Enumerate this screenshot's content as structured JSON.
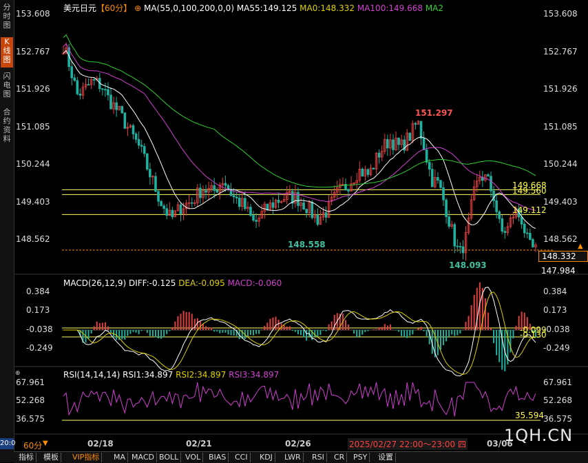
{
  "sidebar": {
    "tabs": [
      "分时图",
      "K线图",
      "闪电图",
      "合约资料"
    ],
    "active": 1,
    "clock": "20:0"
  },
  "header": {
    "symbol": "美元日元",
    "period": "【60分】",
    "ma_params": "MA(55,0,100,200,0,0)",
    "ma55": "MA55:149.125",
    "ma0": "MA0:148.332",
    "ma100": "MA100:149.668",
    "ma2": "MA2"
  },
  "colors": {
    "up": "#e04040",
    "down": "#20b0a0",
    "ma55": "#ffffff",
    "ma0": "#e0d000",
    "ma100": "#d040d0",
    "ma200": "#30d030",
    "gridline": "#ffff66",
    "accent": "#ff8c00"
  },
  "price_axis": {
    "ticks": [
      "153.608",
      "152.767",
      "151.926",
      "151.085",
      "150.244",
      "149.403",
      "148.562"
    ],
    "values": [
      153.608,
      152.767,
      151.926,
      151.085,
      150.244,
      149.403,
      148.562
    ]
  },
  "price_labels": {
    "high": "151.297",
    "low": "148.093",
    "mid_low": "148.558",
    "current": "148.332",
    "extra": "147.984",
    "lines": [
      "149.668",
      "149.560",
      "149.112"
    ]
  },
  "macd": {
    "title": "MACD(26,12,9)",
    "diff": "DIFF:-0.125",
    "dea": "DEA:-0.095",
    "macd": "MACD:-0.060",
    "ticks": [
      "0.384",
      "0.173",
      "-0.038",
      "-0.249"
    ],
    "tag1": "-0.099",
    "tag2": "-0.130"
  },
  "rsi": {
    "title": "RSI(14,14,14)",
    "rsi1": "RSI1:34.897",
    "rsi2": "RSI2:34.897",
    "rsi3": "RSI3:34.897",
    "ticks": [
      "67.961",
      "52.268",
      "36.575"
    ],
    "tag": "35.594"
  },
  "xaxis": {
    "dates": [
      "02/18",
      "02/21",
      "02/26",
      "03/06"
    ],
    "period_label": "60分",
    "cursor_time": "2025/02/27 22:00～23:00 四",
    "watermark": "1QH.CN"
  },
  "tabs": [
    "指标",
    "模板",
    "VIP指标",
    "MA",
    "MACD",
    "BOLL",
    "VOL",
    "BIAS",
    "CCI",
    "KDJ",
    "LWR",
    "RSI",
    "CR",
    "PSY",
    "设置"
  ],
  "chart_data": {
    "type": "candlestick",
    "title": "美元日元",
    "period": "60分",
    "ylim": [
      147.9,
      153.7
    ],
    "x": [
      "02/18",
      "02/21",
      "02/26",
      "03/06"
    ],
    "series": [
      {
        "name": "MA55",
        "values": [
          149.125
        ]
      },
      {
        "name": "MA0",
        "values": [
          148.332
        ]
      },
      {
        "name": "MA100",
        "values": [
          149.668
        ]
      }
    ],
    "extremes": {
      "high": 151.297,
      "low": 148.093,
      "current": 148.332
    },
    "macd": {
      "diff": -0.125,
      "dea": -0.095,
      "macd": -0.06
    },
    "rsi": {
      "rsi1": 34.897,
      "rsi2": 34.897,
      "rsi3": 34.897
    }
  }
}
